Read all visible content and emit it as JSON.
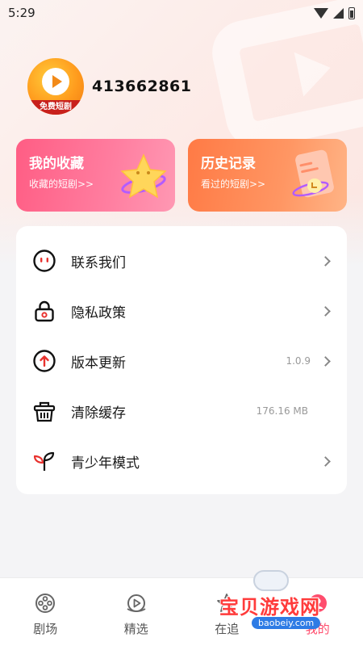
{
  "status_bar": {
    "time": "5:29"
  },
  "profile": {
    "avatar_text": "免费短剧",
    "user_id": "413662861"
  },
  "cards": {
    "favorites": {
      "title": "我的收藏",
      "subtitle": "收藏的短剧>>"
    },
    "history": {
      "title": "历史记录",
      "subtitle": "看过的短剧>>"
    }
  },
  "menu": [
    {
      "label": "联系我们",
      "value": "",
      "icon": "contact-icon"
    },
    {
      "label": "隐私政策",
      "value": "",
      "icon": "lock-icon"
    },
    {
      "label": "版本更新",
      "value": "1.0.9",
      "icon": "update-icon"
    },
    {
      "label": "清除缓存",
      "value": "176.16 MB",
      "icon": "basket-icon"
    },
    {
      "label": "青少年模式",
      "value": "",
      "icon": "sprout-icon"
    }
  ],
  "tabbar": [
    {
      "label": "剧场",
      "icon": "film-reel-icon"
    },
    {
      "label": "精选",
      "icon": "play-circle-icon"
    },
    {
      "label": "在追",
      "icon": "star-icon"
    },
    {
      "label": "我的",
      "icon": "profile-icon"
    }
  ],
  "watermark": {
    "text": "宝贝游戏网",
    "url": "baobeiy.com"
  },
  "colors": {
    "accent_pink": "#ff5d84",
    "accent_orange": "#ff7a45",
    "danger_red": "#e8322e"
  }
}
